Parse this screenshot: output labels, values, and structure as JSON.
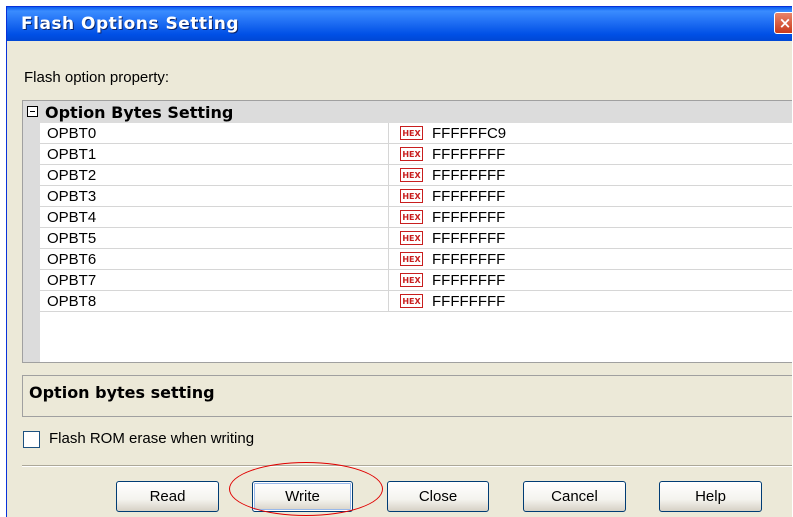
{
  "window": {
    "title": "Flash Options Setting",
    "close_glyph": "×"
  },
  "property_label": "Flash option property:",
  "group": {
    "toggle_glyph": "⊟",
    "title": "Option Bytes Setting",
    "rows": [
      {
        "name": "OPBT0",
        "badge": "HEX",
        "value": "FFFFFFC9"
      },
      {
        "name": "OPBT1",
        "badge": "HEX",
        "value": "FFFFFFFF"
      },
      {
        "name": "OPBT2",
        "badge": "HEX",
        "value": "FFFFFFFF"
      },
      {
        "name": "OPBT3",
        "badge": "HEX",
        "value": "FFFFFFFF"
      },
      {
        "name": "OPBT4",
        "badge": "HEX",
        "value": "FFFFFFFF"
      },
      {
        "name": "OPBT5",
        "badge": "HEX",
        "value": "FFFFFFFF"
      },
      {
        "name": "OPBT6",
        "badge": "HEX",
        "value": "FFFFFFFF"
      },
      {
        "name": "OPBT7",
        "badge": "HEX",
        "value": "FFFFFFFF"
      },
      {
        "name": "OPBT8",
        "badge": "HEX",
        "value": "FFFFFFFF"
      }
    ]
  },
  "description": "Option bytes setting",
  "erase_checkbox": {
    "label": "Flash ROM erase when writing",
    "checked": false
  },
  "buttons": {
    "read": "Read",
    "write": "Write",
    "close": "Close",
    "cancel": "Cancel",
    "help": "Help"
  },
  "colors": {
    "title_bar": "#0054e3",
    "dialog_bg": "#ece9d8",
    "hex_badge": "#c81e1e",
    "highlight_ring": "#e00000"
  }
}
